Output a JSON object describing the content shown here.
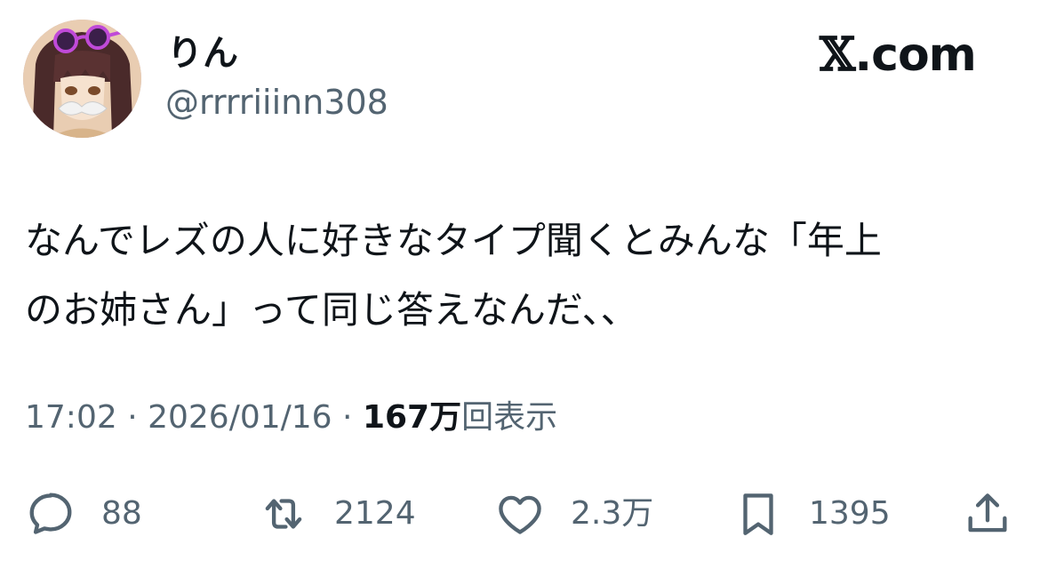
{
  "user": {
    "display_name": "りん",
    "handle": "@rrrriiinn308"
  },
  "brand": {
    "x_glyph": "𝕏",
    "domain": ".com"
  },
  "tweet": {
    "line1": "なんでレズの人に好きなタイプ聞くとみんな「年上",
    "line2": "のお姉さん」って同じ答えなんだ、、"
  },
  "meta": {
    "time": "17:02",
    "separator": " · ",
    "date": "2026/01/16",
    "views_count": "167万",
    "views_label": "回表示"
  },
  "actions": {
    "replies": "88",
    "reposts": "2124",
    "likes": "2.3万",
    "bookmarks": "1395"
  },
  "colors": {
    "text_primary": "#0f1419",
    "text_secondary": "#536471",
    "background": "#ffffff"
  },
  "icons": {
    "reply": "speech-bubble-icon",
    "repost": "repost-arrows-icon",
    "like": "heart-icon",
    "bookmark": "bookmark-icon",
    "share": "share-upload-icon"
  }
}
